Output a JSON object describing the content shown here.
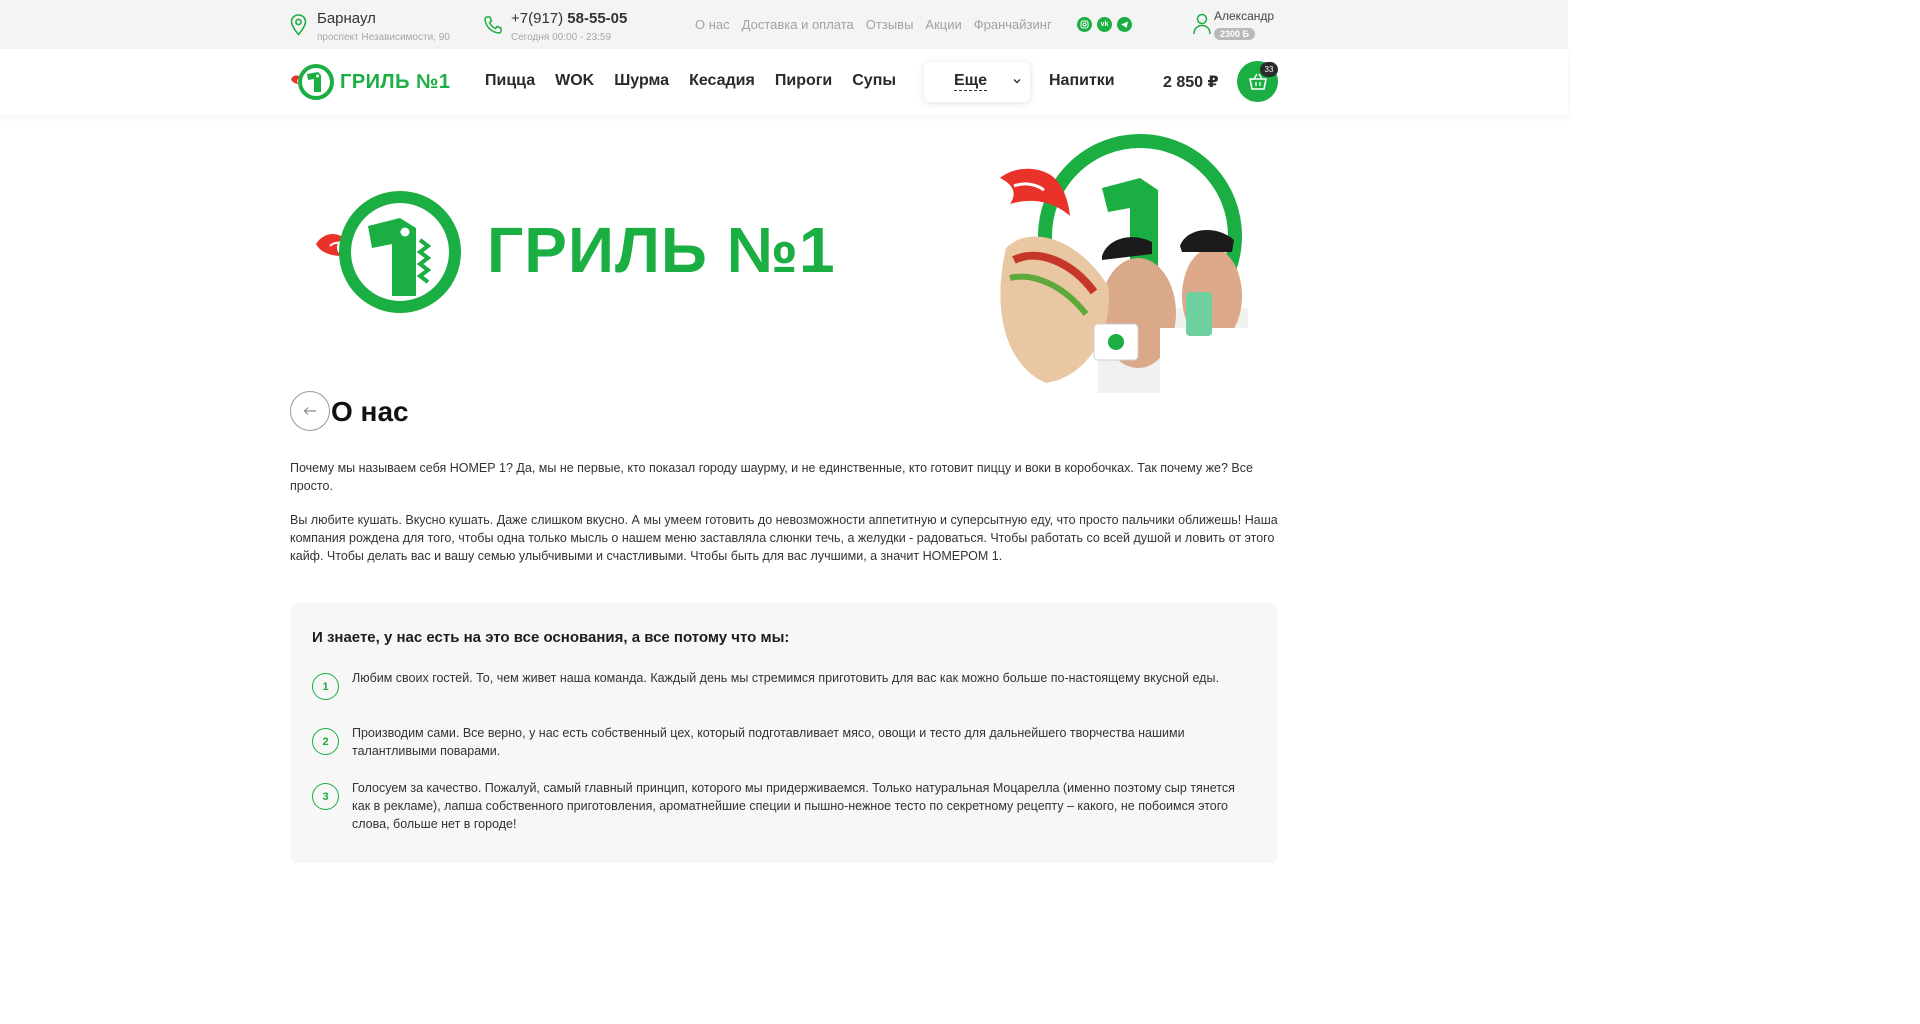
{
  "topbar": {
    "city": "Барнаул",
    "address": "проспект Независимости, 90",
    "phone_prefix": "+7(917)",
    "phone_main": "58-55-05",
    "hours": "Сегодня 00:00 - 23:59",
    "links": [
      "О нас",
      "Доставка и оплата",
      "Отзывы",
      "Акции",
      "Франчайзинг"
    ],
    "socials": [
      "instagram-icon",
      "vk-icon",
      "telegram-icon"
    ],
    "user_name": "Александр",
    "bonus": "2300 Б"
  },
  "header": {
    "logo_text": "ГРИЛЬ №1",
    "nav": [
      "Пицца",
      "WOK",
      "Шурма",
      "Кесадия",
      "Пироги",
      "Супы"
    ],
    "more_label": "Еще",
    "drinks_label": "Напитки",
    "cart_sum": "2 850 ₽",
    "cart_count": "33"
  },
  "hero": {
    "logo_text": "ГРИЛЬ №1"
  },
  "page": {
    "title": "О нас",
    "paragraph1": "Почему мы называем себя НОМЕР 1? Да, мы не первые, кто показал городу шаурму, и не единственные, кто готовит пиццу и воки в коробочках. Так почему же? Все просто.",
    "paragraph2": "Вы любите кушать. Вкусно кушать. Даже слишком вкусно. А мы умеем готовить до невозможности аппетитную и суперсытную еду, что просто пальчики оближешь! Наша компания рождена для того, чтобы одна только мысль о нашем меню заставляла слюнки течь, а желудки - радоваться. Чтобы работать со всей душой и ловить от этого кайф. Чтобы делать вас и вашу семью улыбчивыми и счастливыми. Чтобы быть для вас лучшими, а значит НОМЕРОМ 1."
  },
  "reasons": {
    "title": "И знаете, у нас есть на это все основания, а все потому что мы:",
    "items": [
      {
        "num": "1",
        "text": "Любим своих гостей. То, чем живет наша команда. Каждый день мы стремимся приготовить для вас как можно больше по-настоящему вкусной еды."
      },
      {
        "num": "2",
        "text": "Производим сами. Все верно, у нас есть собственный цех, который подготавливает мясо, овощи и тесто для дальнейшего творчества нашими талантливыми поварами."
      },
      {
        "num": "3",
        "text": "Голосуем за качество. Пожалуй, самый главный принцип, которого мы придерживаемся. Только натуральная Моцарелла (именно поэтому сыр тянется как в рекламе), лапша собственного приготовления, ароматнейшие специи и пышно-нежное тесто по секретному рецепту – какого, не побоимся этого слова, больше нет в городе!"
      }
    ]
  },
  "colors": {
    "brand_green": "#1aae43",
    "flame_red": "#e8322a",
    "topbar_bg": "#f4f4f4",
    "box_bg": "#f7f7f7"
  }
}
